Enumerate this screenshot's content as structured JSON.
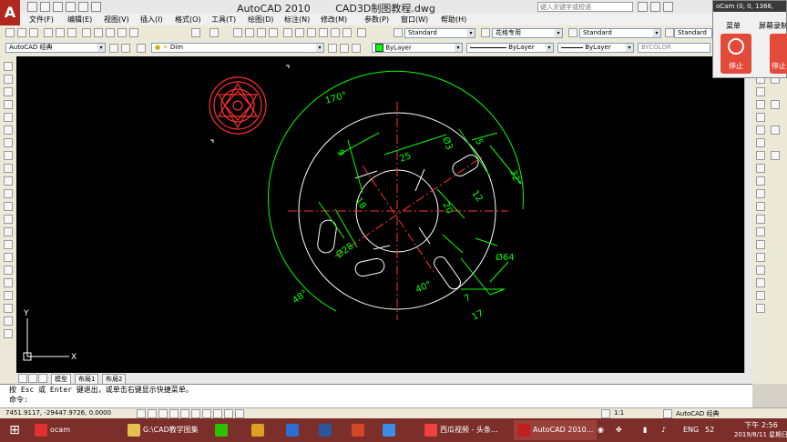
{
  "window": {
    "app_title": "AutoCAD 2010",
    "doc_title": "CAD3D制图教程.dwg",
    "search_placeholder": "键入关键字或短语"
  },
  "menu": [
    "文件(F)",
    "编辑(E)",
    "视图(V)",
    "插入(I)",
    "格式(O)",
    "工具(T)",
    "绘图(D)",
    "标注(N)",
    "修改(M)",
    "参数(P)",
    "窗口(W)",
    "帮助(H)"
  ],
  "toolbar": {
    "text_style": "Standard",
    "dim_style": "花格专用",
    "table_style": "Standard",
    "multileader_style": "Standard",
    "workspace": "AutoCAD 经典",
    "layer": "Dim",
    "color": "ByLayer",
    "linetype": "ByLayer",
    "lineweight": "ByLayer",
    "plotstyle": "BYCOLOR"
  },
  "drawing": {
    "dims": [
      "170°",
      "48°",
      "32°",
      "25",
      "20",
      "18",
      "12",
      "9",
      "5",
      "7",
      "40°",
      "17",
      "Ø28",
      "Ø64",
      "Ø3"
    ],
    "ucs_x": "X",
    "ucs_y": "Y"
  },
  "tabs": [
    "模型",
    "布局1",
    "布局2"
  ],
  "command": {
    "line1": "按 Esc 或 Enter 键退出，或单击右键显示快捷菜单。",
    "line2": "命令:"
  },
  "status": {
    "coords": "7451.9117, -29447.9726, 0.0000",
    "scale": "1:1",
    "workspace": "AutoCAD 经典"
  },
  "ocam": {
    "title": "oCam (0, 0, 1366,",
    "menu_label": "菜单",
    "screen_record_label": "屏幕录制",
    "stop_label": "停止",
    "pause_label": "停止"
  },
  "taskbar": {
    "items": [
      "ocam",
      "G:\\CAD教学图集",
      "西瓜视频 - 头条...",
      "AutoCAD 2010..."
    ],
    "lang": "ENG",
    "battery": "52",
    "time": "下午 2:56",
    "date": "2019/8/11 星期日"
  }
}
